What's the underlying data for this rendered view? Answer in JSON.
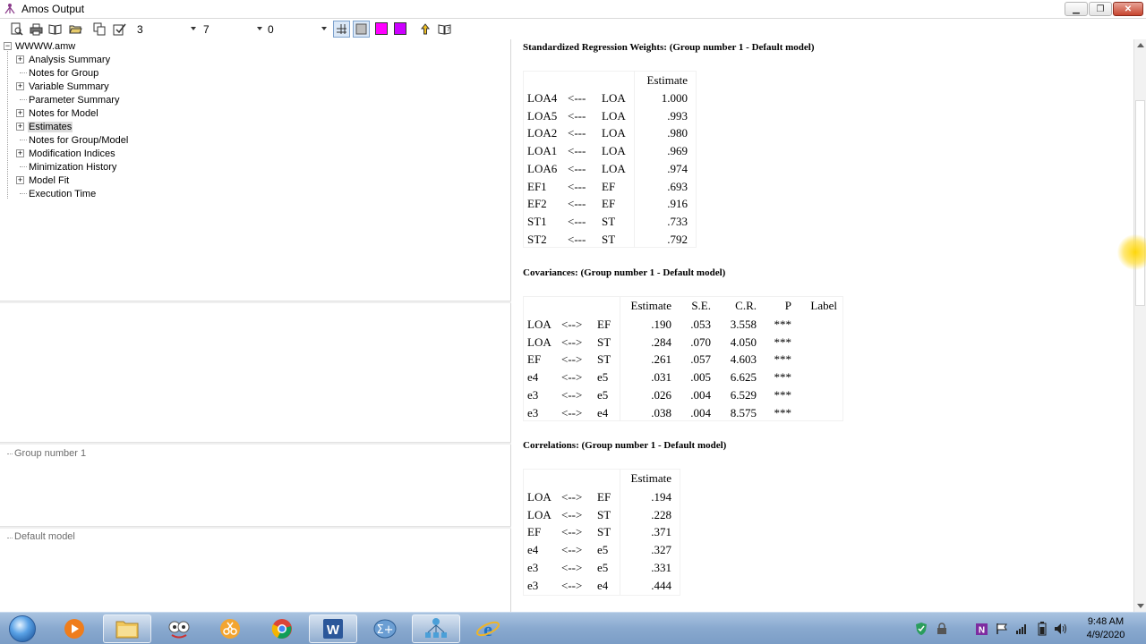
{
  "window": {
    "title": "Amos Output"
  },
  "toolbar": {
    "select1": "3",
    "select2": "7",
    "select3": "0",
    "icons": [
      "preview-icon",
      "print-icon",
      "book-icon",
      "open-folder-icon",
      "copy-icon",
      "checklist-icon"
    ],
    "swatch_colors": [
      "#ff00ff",
      "#cc00ff"
    ]
  },
  "tree": {
    "root": "WWWW.amw",
    "items": [
      {
        "label": "Analysis Summary",
        "expandable": true
      },
      {
        "label": "Notes for Group",
        "expandable": false
      },
      {
        "label": "Variable Summary",
        "expandable": true
      },
      {
        "label": "Parameter Summary",
        "expandable": false
      },
      {
        "label": "Notes for Model",
        "expandable": true
      },
      {
        "label": "Estimates",
        "expandable": true,
        "selected": true
      },
      {
        "label": "Notes for Group/Model",
        "expandable": false
      },
      {
        "label": "Modification Indices",
        "expandable": true
      },
      {
        "label": "Minimization History",
        "expandable": false
      },
      {
        "label": "Model Fit",
        "expandable": true
      },
      {
        "label": "Execution Time",
        "expandable": false
      }
    ]
  },
  "groups": {
    "group_label": "Group number 1",
    "model_label": "Default model"
  },
  "standardized": {
    "title": "Standardized Regression Weights: (Group number 1 - Default model)",
    "header": "Estimate",
    "rows": [
      [
        "LOA4",
        "<---",
        "LOA",
        "1.000"
      ],
      [
        "LOA5",
        "<---",
        "LOA",
        ".993"
      ],
      [
        "LOA2",
        "<---",
        "LOA",
        ".980"
      ],
      [
        "LOA1",
        "<---",
        "LOA",
        ".969"
      ],
      [
        "LOA6",
        "<---",
        "LOA",
        ".974"
      ],
      [
        "EF1",
        "<---",
        "EF",
        ".693"
      ],
      [
        "EF2",
        "<---",
        "EF",
        ".916"
      ],
      [
        "ST1",
        "<---",
        "ST",
        ".733"
      ],
      [
        "ST2",
        "<---",
        "ST",
        ".792"
      ]
    ]
  },
  "covariances": {
    "title": "Covariances: (Group number 1 - Default model)",
    "headers": [
      "Estimate",
      "S.E.",
      "C.R.",
      "P",
      "Label"
    ],
    "rows": [
      [
        "LOA",
        "<-->",
        "EF",
        ".190",
        ".053",
        "3.558",
        "***",
        ""
      ],
      [
        "LOA",
        "<-->",
        "ST",
        ".284",
        ".070",
        "4.050",
        "***",
        ""
      ],
      [
        "EF",
        "<-->",
        "ST",
        ".261",
        ".057",
        "4.603",
        "***",
        ""
      ],
      [
        "e4",
        "<-->",
        "e5",
        ".031",
        ".005",
        "6.625",
        "***",
        ""
      ],
      [
        "e3",
        "<-->",
        "e5",
        ".026",
        ".004",
        "6.529",
        "***",
        ""
      ],
      [
        "e3",
        "<-->",
        "e4",
        ".038",
        ".004",
        "8.575",
        "***",
        ""
      ]
    ]
  },
  "correlations": {
    "title": "Correlations: (Group number 1 - Default model)",
    "header": "Estimate",
    "rows": [
      [
        "LOA",
        "<-->",
        "EF",
        ".194"
      ],
      [
        "LOA",
        "<-->",
        "ST",
        ".228"
      ],
      [
        "EF",
        "<-->",
        "ST",
        ".371"
      ],
      [
        "e4",
        "<-->",
        "e5",
        ".327"
      ],
      [
        "e3",
        "<-->",
        "e5",
        ".331"
      ],
      [
        "e3",
        "<-->",
        "e4",
        ".444"
      ]
    ]
  },
  "taskbar": {
    "apps": [
      "media-player-icon",
      "file-explorer-icon",
      "app-face-icon",
      "scissors-app-icon",
      "chrome-icon",
      "word-icon",
      "spss-sigma-icon",
      "amos-graphics-icon",
      "internet-explorer-icon"
    ],
    "clock_time": "9:48 AM",
    "clock_date": "4/9/2020"
  }
}
